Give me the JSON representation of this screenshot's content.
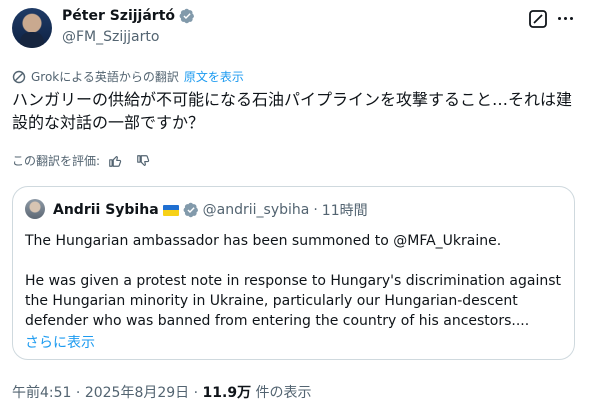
{
  "author": {
    "name": "Péter Szijjártó",
    "handle": "@FM_Szijjarto"
  },
  "translation": {
    "note": "Grokによる英語からの翻訳",
    "original_link": "原文を表示",
    "rate_label": "この翻訳を評価:"
  },
  "tweet": {
    "text": "ハンガリーの供給が不可能になる石油パイプラインを攻撃すること…それは建設的な対話の一部ですか？"
  },
  "quote": {
    "name": "Andrii Sybiha",
    "handle": "@andrii_sybiha",
    "separator": "·",
    "time": "11時間",
    "line1": "The Hungarian ambassador has been summoned to @MFA_Ukraine.",
    "line2": "He was given a protest note in response to Hungary's discrimination against the Hungarian minority in Ukraine, particularly our Hungarian-descent defender who was banned from entering the country of his ancestors....",
    "show_more": "さらに表示"
  },
  "footer": {
    "time": "午前4:51",
    "separator": "·",
    "date": "2025年8月29日",
    "separator2": "·",
    "views": "11.9万",
    "views_label": "件の表示"
  },
  "colors": {
    "link": "#1d9bf0",
    "muted": "#536471",
    "verified": "#829aab"
  }
}
